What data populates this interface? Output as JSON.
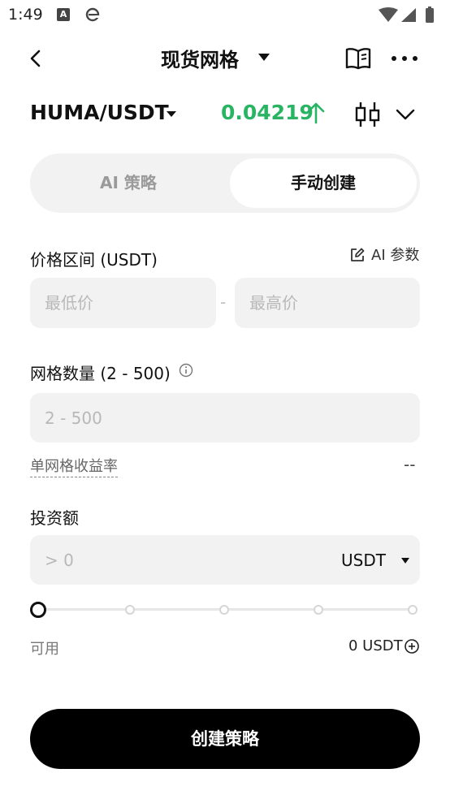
{
  "status_bar": {
    "time": "1:49",
    "app_a_glyph": "A",
    "app_e_glyph": "e"
  },
  "header": {
    "title": "现货网格"
  },
  "pair": {
    "symbol": "HUMA/USDT",
    "price": "0.04219",
    "price_color": "#28b463"
  },
  "tabs": [
    {
      "label": "AI 策略",
      "active": false
    },
    {
      "label": "手动创建",
      "active": true
    }
  ],
  "price_range": {
    "label": "价格区间 (USDT)",
    "ai_params_label": "AI 参数",
    "min_placeholder": "最低价",
    "max_placeholder": "最高价",
    "separator": "-"
  },
  "grid_count": {
    "label": "网格数量 (2 - 500)",
    "placeholder": "2 - 500"
  },
  "yield": {
    "label": "单网格收益率",
    "value": "--"
  },
  "investment": {
    "label": "投资额",
    "placeholder": "> 0",
    "currency": "USDT",
    "slider_percent": 0
  },
  "available": {
    "label": "可用",
    "value": "0 USDT"
  },
  "create_button": {
    "label": "创建策略"
  },
  "icons": {
    "back": "chevron-left-icon",
    "title_caret": "caret-down-icon",
    "guide": "book-icon",
    "more": "more-dots-icon",
    "pair_caret": "caret-down-icon",
    "price_trend": "arrow-up-icon",
    "chart": "candlestick-icon",
    "expand": "chevron-down-icon",
    "edit": "edit-icon",
    "info": "info-icon",
    "add": "plus-circle-icon"
  }
}
